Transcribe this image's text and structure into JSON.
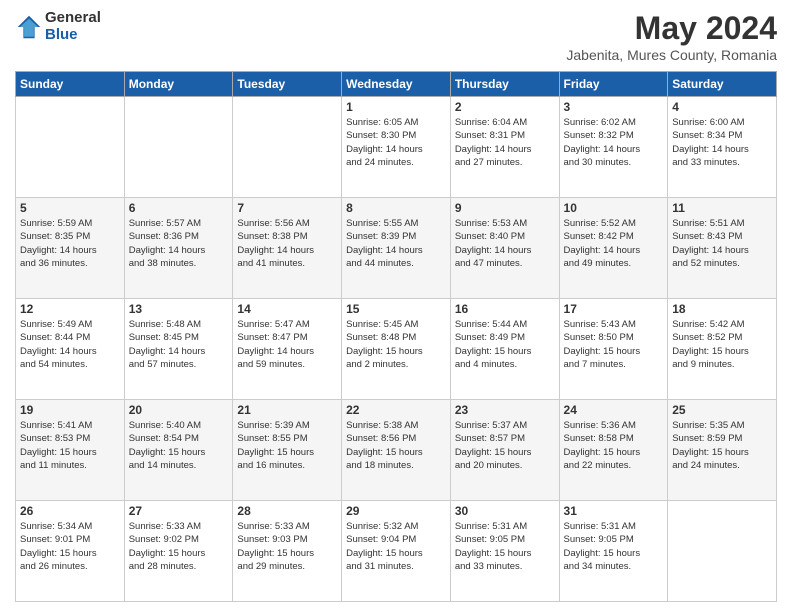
{
  "logo": {
    "general": "General",
    "blue": "Blue"
  },
  "title": "May 2024",
  "subtitle": "Jabenita, Mures County, Romania",
  "weekdays": [
    "Sunday",
    "Monday",
    "Tuesday",
    "Wednesday",
    "Thursday",
    "Friday",
    "Saturday"
  ],
  "weeks": [
    [
      {
        "day": "",
        "info": ""
      },
      {
        "day": "",
        "info": ""
      },
      {
        "day": "",
        "info": ""
      },
      {
        "day": "1",
        "info": "Sunrise: 6:05 AM\nSunset: 8:30 PM\nDaylight: 14 hours\nand 24 minutes."
      },
      {
        "day": "2",
        "info": "Sunrise: 6:04 AM\nSunset: 8:31 PM\nDaylight: 14 hours\nand 27 minutes."
      },
      {
        "day": "3",
        "info": "Sunrise: 6:02 AM\nSunset: 8:32 PM\nDaylight: 14 hours\nand 30 minutes."
      },
      {
        "day": "4",
        "info": "Sunrise: 6:00 AM\nSunset: 8:34 PM\nDaylight: 14 hours\nand 33 minutes."
      }
    ],
    [
      {
        "day": "5",
        "info": "Sunrise: 5:59 AM\nSunset: 8:35 PM\nDaylight: 14 hours\nand 36 minutes."
      },
      {
        "day": "6",
        "info": "Sunrise: 5:57 AM\nSunset: 8:36 PM\nDaylight: 14 hours\nand 38 minutes."
      },
      {
        "day": "7",
        "info": "Sunrise: 5:56 AM\nSunset: 8:38 PM\nDaylight: 14 hours\nand 41 minutes."
      },
      {
        "day": "8",
        "info": "Sunrise: 5:55 AM\nSunset: 8:39 PM\nDaylight: 14 hours\nand 44 minutes."
      },
      {
        "day": "9",
        "info": "Sunrise: 5:53 AM\nSunset: 8:40 PM\nDaylight: 14 hours\nand 47 minutes."
      },
      {
        "day": "10",
        "info": "Sunrise: 5:52 AM\nSunset: 8:42 PM\nDaylight: 14 hours\nand 49 minutes."
      },
      {
        "day": "11",
        "info": "Sunrise: 5:51 AM\nSunset: 8:43 PM\nDaylight: 14 hours\nand 52 minutes."
      }
    ],
    [
      {
        "day": "12",
        "info": "Sunrise: 5:49 AM\nSunset: 8:44 PM\nDaylight: 14 hours\nand 54 minutes."
      },
      {
        "day": "13",
        "info": "Sunrise: 5:48 AM\nSunset: 8:45 PM\nDaylight: 14 hours\nand 57 minutes."
      },
      {
        "day": "14",
        "info": "Sunrise: 5:47 AM\nSunset: 8:47 PM\nDaylight: 14 hours\nand 59 minutes."
      },
      {
        "day": "15",
        "info": "Sunrise: 5:45 AM\nSunset: 8:48 PM\nDaylight: 15 hours\nand 2 minutes."
      },
      {
        "day": "16",
        "info": "Sunrise: 5:44 AM\nSunset: 8:49 PM\nDaylight: 15 hours\nand 4 minutes."
      },
      {
        "day": "17",
        "info": "Sunrise: 5:43 AM\nSunset: 8:50 PM\nDaylight: 15 hours\nand 7 minutes."
      },
      {
        "day": "18",
        "info": "Sunrise: 5:42 AM\nSunset: 8:52 PM\nDaylight: 15 hours\nand 9 minutes."
      }
    ],
    [
      {
        "day": "19",
        "info": "Sunrise: 5:41 AM\nSunset: 8:53 PM\nDaylight: 15 hours\nand 11 minutes."
      },
      {
        "day": "20",
        "info": "Sunrise: 5:40 AM\nSunset: 8:54 PM\nDaylight: 15 hours\nand 14 minutes."
      },
      {
        "day": "21",
        "info": "Sunrise: 5:39 AM\nSunset: 8:55 PM\nDaylight: 15 hours\nand 16 minutes."
      },
      {
        "day": "22",
        "info": "Sunrise: 5:38 AM\nSunset: 8:56 PM\nDaylight: 15 hours\nand 18 minutes."
      },
      {
        "day": "23",
        "info": "Sunrise: 5:37 AM\nSunset: 8:57 PM\nDaylight: 15 hours\nand 20 minutes."
      },
      {
        "day": "24",
        "info": "Sunrise: 5:36 AM\nSunset: 8:58 PM\nDaylight: 15 hours\nand 22 minutes."
      },
      {
        "day": "25",
        "info": "Sunrise: 5:35 AM\nSunset: 8:59 PM\nDaylight: 15 hours\nand 24 minutes."
      }
    ],
    [
      {
        "day": "26",
        "info": "Sunrise: 5:34 AM\nSunset: 9:01 PM\nDaylight: 15 hours\nand 26 minutes."
      },
      {
        "day": "27",
        "info": "Sunrise: 5:33 AM\nSunset: 9:02 PM\nDaylight: 15 hours\nand 28 minutes."
      },
      {
        "day": "28",
        "info": "Sunrise: 5:33 AM\nSunset: 9:03 PM\nDaylight: 15 hours\nand 29 minutes."
      },
      {
        "day": "29",
        "info": "Sunrise: 5:32 AM\nSunset: 9:04 PM\nDaylight: 15 hours\nand 31 minutes."
      },
      {
        "day": "30",
        "info": "Sunrise: 5:31 AM\nSunset: 9:05 PM\nDaylight: 15 hours\nand 33 minutes."
      },
      {
        "day": "31",
        "info": "Sunrise: 5:31 AM\nSunset: 9:05 PM\nDaylight: 15 hours\nand 34 minutes."
      },
      {
        "day": "",
        "info": ""
      }
    ]
  ]
}
